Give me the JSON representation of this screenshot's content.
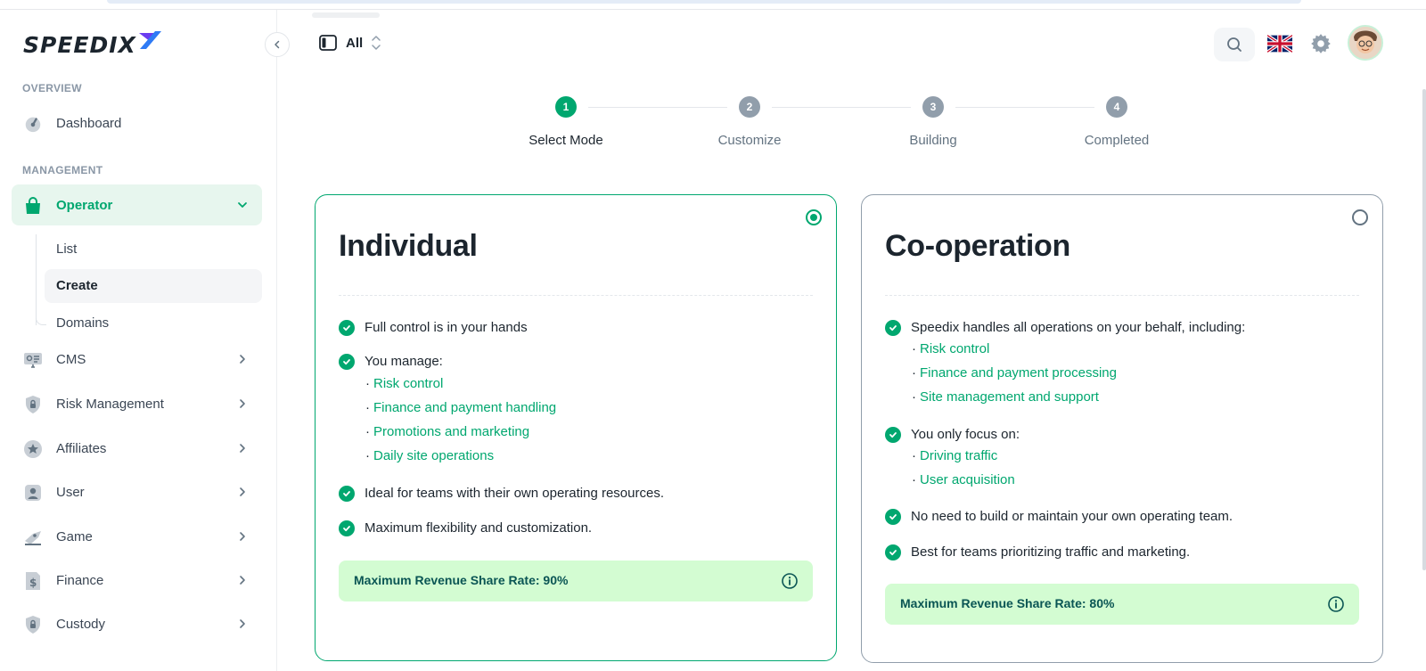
{
  "brand": {
    "name": "SPEEDIX"
  },
  "sidebar": {
    "overview_label": "OVERVIEW",
    "management_label": "MANAGEMENT",
    "dashboard": "Dashboard",
    "operator": "Operator",
    "operator_sub": [
      "List",
      "Create",
      "Domains"
    ],
    "items": [
      "CMS",
      "Risk Management",
      "Affiliates",
      "User",
      "Game",
      "Finance",
      "Custody"
    ]
  },
  "header": {
    "scope_value": "All",
    "icons": [
      "sidebar-toggle-icon",
      "search-icon",
      "uk-flag-icon",
      "gear-icon",
      "avatar"
    ]
  },
  "stepper": {
    "steps": [
      {
        "number": "1",
        "label": "Select Mode"
      },
      {
        "number": "2",
        "label": "Customize"
      },
      {
        "number": "3",
        "label": "Building"
      },
      {
        "number": "4",
        "label": "Completed"
      }
    ],
    "active_step": 1
  },
  "cards": {
    "individual": {
      "title": "Individual",
      "selected": true,
      "feature1": "Full control is in your hands",
      "feature2": "You manage:",
      "bullets": [
        "Risk control",
        "Finance and payment handling",
        "Promotions and marketing",
        "Daily site operations"
      ],
      "feature3": "Ideal for teams with their own operating resources.",
      "feature4": "Maximum flexibility and customization.",
      "revenue": "Maximum Revenue Share Rate: 90%"
    },
    "cooperation": {
      "title": "Co-operation",
      "selected": false,
      "feature1": "Speedix handles all operations on your behalf, including:",
      "bullets1": [
        "Risk control",
        "Finance and payment processing",
        "Site management and support"
      ],
      "feature2": "You only focus on:",
      "bullets2": [
        "Driving traffic",
        "User acquisition"
      ],
      "feature3": "No need to build or maintain your own operating team.",
      "feature4": "Best for teams prioritizing traffic and marketing.",
      "revenue": "Maximum Revenue Share Rate: 80%"
    }
  },
  "colors": {
    "accent": "#00a76f",
    "accent_light": "#e7f6ee",
    "revenue_bg": "#d3fcd2",
    "revenue_text": "#0a5554",
    "muted": "#919eab"
  }
}
